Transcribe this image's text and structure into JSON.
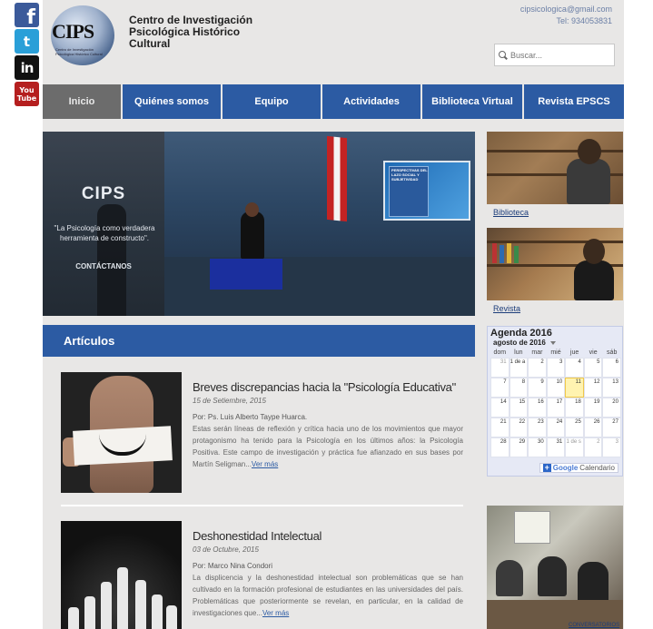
{
  "social": {
    "facebook": "f",
    "twitter": "t",
    "linkedin": "in",
    "youtube_top": "You",
    "youtube_bottom": "Tube"
  },
  "header": {
    "logo_text": "CIPS",
    "logo_sub": "Centro de Investigación Psicológica Histórico Cultural",
    "site_title": "Centro de Investigación Psicológica Histórico Cultural",
    "email": "cipsicologica@gmail.com",
    "phone": "Tel: 934053831",
    "search_placeholder": "Buscar..."
  },
  "nav": {
    "items": [
      {
        "label": "Inicio",
        "active": true
      },
      {
        "label": "Quiénes somos"
      },
      {
        "label": "Equipo"
      },
      {
        "label": "Actividades"
      },
      {
        "label": "Biblioteca Virtual"
      },
      {
        "label": "Revista EPSCS"
      }
    ]
  },
  "hero": {
    "brand": "CIPS",
    "quote": "\"La Psicología como verdadera herramienta de constructo\".",
    "contact": "CONTÁCTANOS",
    "screen_text": "PERSPECTIVAS DEL LAZO SOCIAL Y SUBJETIVIDAD"
  },
  "articles": {
    "heading": "Artículos",
    "items": [
      {
        "title": "Breves discrepancias hacia la \"Psicología Educativa\"",
        "date": "15 de Setiembre, 2015",
        "author": "Por: Ps. Luis Alberto Taype Huarca.",
        "text": "Estas serán líneas de reflexión y crítica hacia uno de los movimientos que mayor protagonismo ha tenido para la Psicología en los últimos años: la Psicología Positiva. Este campo de investigación y práctica fue afianzado en sus bases por Martín Seligman...",
        "more": "Ver más"
      },
      {
        "title": "Deshonestidad Intelectual",
        "date": "03 de Octubre, 2015",
        "author": "Por: Marco Nina Condori",
        "text": "La displicencia y la deshonestidad intelectual son problemáticas que se han cultivado en la formación profesional de estudiantes en las universidades del país. Problemáticas que posteriormente se revelan, en particular, en la calidad de investigaciones que...",
        "more": "Ver más"
      }
    ]
  },
  "sidebar": {
    "biblioteca": "Biblioteca",
    "revista": "Revista",
    "conversatorios": "CONVERSATORIOS"
  },
  "calendar": {
    "title": "Agenda 2016",
    "month": "agosto de 2016",
    "dow": [
      "dom",
      "lun",
      "mar",
      "mié",
      "jue",
      "vie",
      "sáb"
    ],
    "weeks": [
      [
        {
          "d": "31",
          "o": true
        },
        {
          "d": "1 de a"
        },
        {
          "d": "2"
        },
        {
          "d": "3"
        },
        {
          "d": "4"
        },
        {
          "d": "5"
        },
        {
          "d": "6"
        }
      ],
      [
        {
          "d": "7"
        },
        {
          "d": "8"
        },
        {
          "d": "9"
        },
        {
          "d": "10"
        },
        {
          "d": "11",
          "t": true
        },
        {
          "d": "12"
        },
        {
          "d": "13"
        }
      ],
      [
        {
          "d": "14"
        },
        {
          "d": "15"
        },
        {
          "d": "16"
        },
        {
          "d": "17"
        },
        {
          "d": "18"
        },
        {
          "d": "19"
        },
        {
          "d": "20"
        }
      ],
      [
        {
          "d": "21"
        },
        {
          "d": "22"
        },
        {
          "d": "23"
        },
        {
          "d": "24"
        },
        {
          "d": "25"
        },
        {
          "d": "26"
        },
        {
          "d": "27"
        }
      ],
      [
        {
          "d": "28"
        },
        {
          "d": "29"
        },
        {
          "d": "30"
        },
        {
          "d": "31"
        },
        {
          "d": "1 de s",
          "o": true
        },
        {
          "d": "2",
          "o": true
        },
        {
          "d": "3",
          "o": true
        }
      ]
    ],
    "footer_google": "Google",
    "footer_label": "Calendario"
  },
  "colors": {
    "nav_blue": "#2c5ba3",
    "nav_active": "#6c6c6c",
    "page_bg": "#e8e7e6"
  }
}
